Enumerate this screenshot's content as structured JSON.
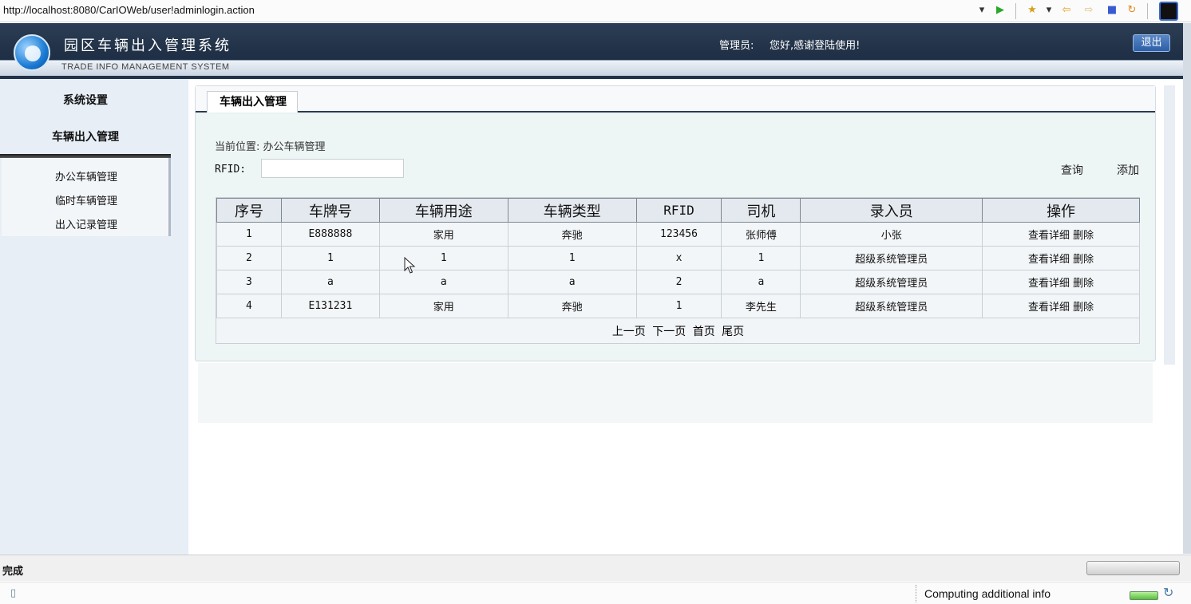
{
  "browser": {
    "url": "http://localhost:8080/CarIOWeb/user!adminlogin.action",
    "dropdown_icon": "▾",
    "go_icon": "▶",
    "star_icon": "★",
    "back_icon": "⇦",
    "forward_icon": "⇨",
    "stop_icon": "■",
    "refresh_icon": "↻"
  },
  "header": {
    "title": "园区车辆出入管理系统",
    "subtitle": "TRADE INFO MANAGEMENT SYSTEM",
    "admin_label": "管理员:",
    "welcome": "您好,感谢登陆使用!",
    "logout": "退出"
  },
  "sidebar": {
    "sections": [
      {
        "label": "系统设置"
      },
      {
        "label": "车辆出入管理"
      }
    ],
    "items": [
      {
        "label": "办公车辆管理"
      },
      {
        "label": "临时车辆管理"
      },
      {
        "label": "出入记录管理"
      }
    ]
  },
  "main": {
    "tab": "车辆出入管理",
    "breadcrumb": "当前位置: 办公车辆管理",
    "rfid_label": "RFID:",
    "rfid_value": "",
    "query": "查询",
    "add": "添加",
    "table": {
      "headers": [
        "序号",
        "车牌号",
        "车辆用途",
        "车辆类型",
        "RFID",
        "司机",
        "录入员",
        "操作"
      ],
      "rows": [
        {
          "no": "1",
          "plate": "E888888",
          "usage": "家用",
          "type": "奔驰",
          "rfid": "123456",
          "driver": "张师傅",
          "operator": "小张"
        },
        {
          "no": "2",
          "plate": "1",
          "usage": "1",
          "type": "1",
          "rfid": "x",
          "driver": "1",
          "operator": "超级系统管理员"
        },
        {
          "no": "3",
          "plate": "a",
          "usage": "a",
          "type": "a",
          "rfid": "2",
          "driver": "a",
          "operator": "超级系统管理员"
        },
        {
          "no": "4",
          "plate": "E131231",
          "usage": "家用",
          "type": "奔驰",
          "rfid": "1",
          "driver": "李先生",
          "operator": "超级系统管理员"
        }
      ],
      "action_view": "查看详细",
      "action_delete": "删除"
    },
    "pager": {
      "prev": "上一页",
      "next": "下一页",
      "first": "首页",
      "last": "尾页"
    }
  },
  "status": {
    "left": "完成",
    "info": "Computing additional info"
  }
}
